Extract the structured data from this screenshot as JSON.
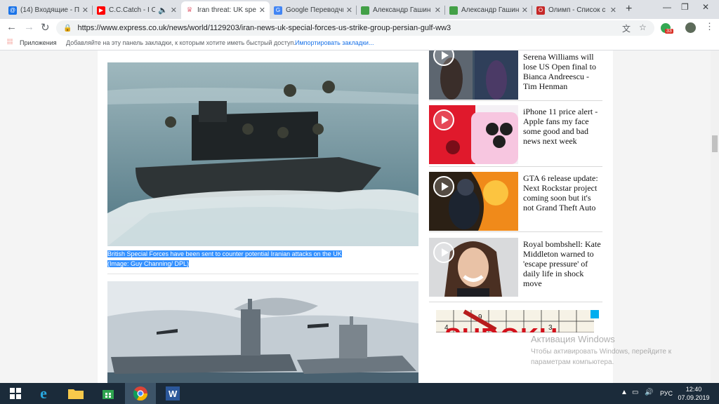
{
  "browser": {
    "tabs": [
      {
        "label": "(14) Входящие - П",
        "favicon": "mail-icon",
        "color": "#1a73e8"
      },
      {
        "label": "C.C.Catch - I Ca",
        "favicon": "youtube-icon",
        "color": "#ff0000"
      },
      {
        "label": "Iran threat: UK spe",
        "favicon": "express-icon",
        "color": "#d1122c"
      },
      {
        "label": "Google Переводчи",
        "favicon": "translate-icon",
        "color": "#4285f4"
      },
      {
        "label": "Александр Гашин",
        "favicon": "doc-icon",
        "color": "#43a047"
      },
      {
        "label": "Александр Гашин",
        "favicon": "doc-icon",
        "color": "#43a047"
      },
      {
        "label": "Олимп - Список с",
        "favicon": "olimp-icon",
        "color": "#c62828"
      }
    ],
    "new_tab": "+",
    "window_controls": {
      "minimize": "—",
      "restore": "❐",
      "close": "✕"
    },
    "url": "https://www.express.co.uk/news/world/1129203/iran-news-uk-special-forces-us-strike-group-persian-gulf-ww3",
    "extension_badge": "33"
  },
  "bookmarks": {
    "apps": "Приложения",
    "hint": "Добавляйте на эту панель закладки, к которым хотите иметь быстрый доступ.",
    "import": "Импортировать закладки..."
  },
  "article": {
    "caption_line1": "British Special Forces have been sent to counter potential Iranian attacks on the UK",
    "caption_line2": "(Image: Guy Channing/ DPL)"
  },
  "sidebar": {
    "items": [
      {
        "title": "Serena Williams will lose US Open final to Bianca Andreescu - Tim Henman"
      },
      {
        "title": "iPhone 11 price alert - Apple fans my face some good and bad news next week"
      },
      {
        "title": "GTA 6 release update: Next Rockstar project coming soon but it's not Grand Theft Auto"
      },
      {
        "title": "Royal bombshell: Kate Middleton warned to 'escape pressure' of daily life in shock move"
      }
    ],
    "ad_text": "SUDOKU"
  },
  "watermark": {
    "title": "Активация Windows",
    "body": "Чтобы активировать Windows, перейдите к параметрам компьютера."
  },
  "taskbar": {
    "lang": "РУС",
    "time": "12:40",
    "date": "07.09.2019"
  }
}
